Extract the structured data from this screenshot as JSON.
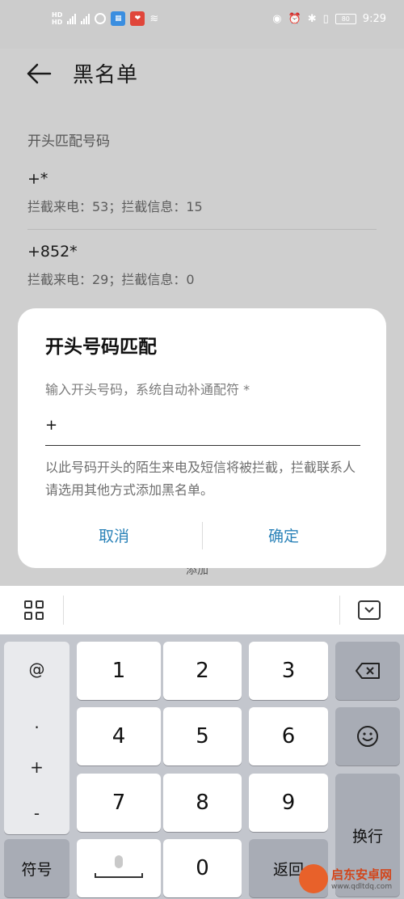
{
  "status_bar": {
    "network_left": "HD",
    "network_left2": "HD",
    "time": "9:29",
    "battery": "80"
  },
  "header": {
    "title": "黑名单"
  },
  "section": {
    "title": "开头匹配号码"
  },
  "rules": [
    {
      "pattern": "+*",
      "stats": "拦截来电：53；拦截信息：15"
    },
    {
      "pattern": "+852*",
      "stats": "拦截来电：29；拦截信息：0"
    }
  ],
  "bottom": {
    "add_label": "添加"
  },
  "dialog": {
    "title": "开头号码匹配",
    "hint": "输入开头号码，系统自动补通配符 *",
    "input_value": "+",
    "note": "以此号码开头的陌生来电及短信将被拦截，拦截联系人请选用其他方式添加黑名单。",
    "cancel_label": "取消",
    "ok_label": "确定"
  },
  "keyboard": {
    "symbols": [
      "@",
      ".",
      "+",
      "-"
    ],
    "keys": [
      "1",
      "2",
      "3",
      "4",
      "5",
      "6",
      "7",
      "8",
      "9",
      "0"
    ],
    "sym_label": "符号",
    "return_label": "返回",
    "newline_label": "换行"
  },
  "watermark": {
    "title": "启东安卓网",
    "url": "www.qdltdq.com"
  },
  "colors": {
    "accent": "#2a82b8",
    "dim_bg": "#cfcfcf",
    "keyboard_bg": "#c3c6cd"
  }
}
